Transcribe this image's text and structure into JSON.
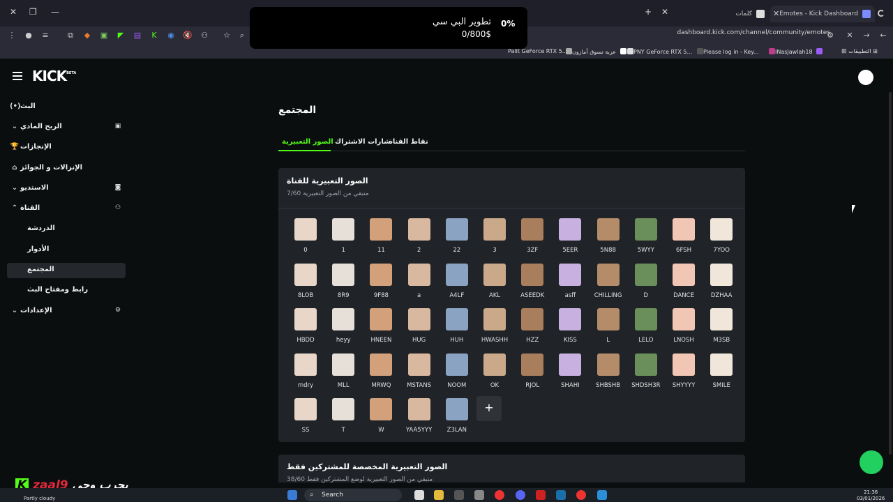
{
  "browser": {
    "tabs": [
      {
        "label": "Emotes - Kick Dashboard",
        "active": true
      },
      {
        "label": "كلمات",
        "active": false
      }
    ],
    "url": "dashboard.kick.com/channel/community/emotes",
    "bookmarks": [
      {
        "label": "التطبيقات"
      },
      {
        "label": "INasJawlah18"
      },
      {
        "label": "Please log in - Key..."
      },
      {
        "label": "PNY GeForce RTX 5..."
      },
      {
        "label": "عربة تسوق أمازون"
      },
      {
        "label": "Palit GeForce RTX 5..."
      }
    ]
  },
  "overlay": {
    "percent": "0%",
    "title": "تطوير البي سي",
    "amount": "0/800$"
  },
  "header": {
    "logo": "KICK",
    "beta": "BETA"
  },
  "sidebar": {
    "items": [
      {
        "label": "البث"
      },
      {
        "label": "الربح المادي"
      },
      {
        "label": "الإنجازات"
      },
      {
        "label": "الإنزالات و الجوائز"
      },
      {
        "label": "الاستديو"
      },
      {
        "label": "القناة"
      },
      {
        "label": "الدردشة"
      },
      {
        "label": "الأدوار"
      },
      {
        "label": "المجتمع"
      },
      {
        "label": "رابط ومفتاح البث"
      },
      {
        "label": "الإعدادات"
      }
    ]
  },
  "main": {
    "title": "المجتمع",
    "tabs": [
      {
        "label": "الصور التعبيرية",
        "active": true
      },
      {
        "label": "شارات الاشتراك",
        "active": false
      },
      {
        "label": "نقاط القناة",
        "active": false
      }
    ],
    "channel_emotes": {
      "title": "الصور التعبيرية للقناة",
      "subtitle": "7/60 متبقي من الصور التعبيرية",
      "emotes": [
        "0",
        "1",
        "11",
        "2",
        "22",
        "3",
        "3ZF",
        "5EER",
        "5N88",
        "5WYY",
        "6FSH",
        "7YOO",
        "8LOB",
        "8R9",
        "9F88",
        "a",
        "A4LF",
        "AKL",
        "ASEEDK",
        "asff",
        "CHILLING",
        "D",
        "DANCE",
        "DZHAA",
        "HBDD",
        "heyy",
        "HNEEN",
        "HUG",
        "HUH",
        "HWASHH",
        "HZZ",
        "KISS",
        "L",
        "LELO",
        "LNOSH",
        "M3SB",
        "mdry",
        "MLL",
        "MRWQ",
        "MSTANS",
        "NOOM",
        "OK",
        "RJOL",
        "SHAHI",
        "SHBSHB",
        "SHDSH3R",
        "SHYYYY",
        "SMILE",
        "SS",
        "T",
        "W",
        "YAA5YYY",
        "Z3LAN"
      ],
      "add_label": "+"
    },
    "sub_emotes": {
      "title_highlight": "الصور التعبيرية المخصصة للمشتركين فقط",
      "subtitle": "38/60 متبقي من الصور التعبيرية لوضع المشتركين فقط"
    }
  },
  "stream_overlay": {
    "k": "K",
    "name": "zaal9",
    "tagline": "بجرب وحي"
  },
  "taskbar": {
    "weather": "Partly cloudy",
    "search": "Search",
    "time": "21:36",
    "date": "03/01/2026"
  },
  "colors": {
    "accent": "#53fc18",
    "panel": "#202328",
    "background": "#0b0e0f"
  }
}
